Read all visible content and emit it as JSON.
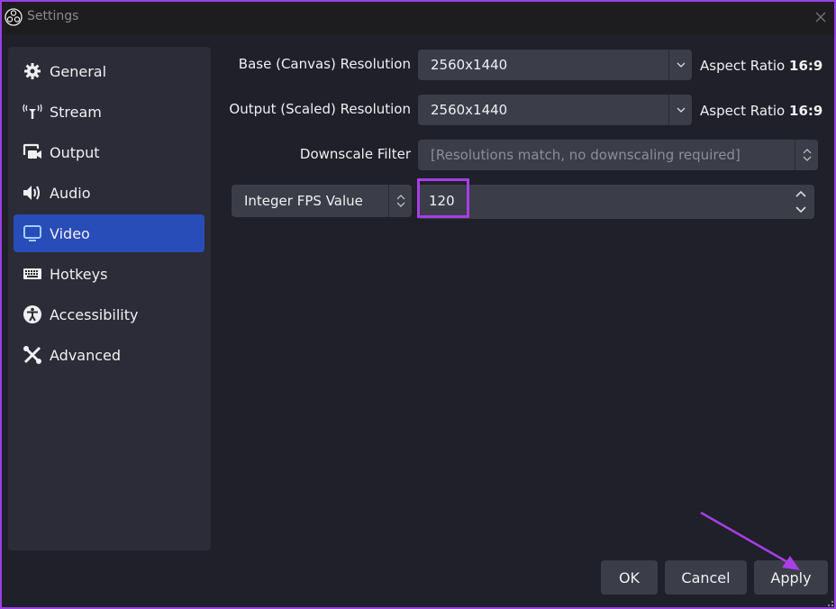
{
  "window": {
    "title": "Settings"
  },
  "sidebar": {
    "items": [
      {
        "label": "General",
        "icon": "gear-icon"
      },
      {
        "label": "Stream",
        "icon": "antenna-icon"
      },
      {
        "label": "Output",
        "icon": "output-icon"
      },
      {
        "label": "Audio",
        "icon": "speaker-icon"
      },
      {
        "label": "Video",
        "icon": "monitor-icon",
        "active": true
      },
      {
        "label": "Hotkeys",
        "icon": "keyboard-icon"
      },
      {
        "label": "Accessibility",
        "icon": "accessibility-icon"
      },
      {
        "label": "Advanced",
        "icon": "tools-icon"
      }
    ]
  },
  "video": {
    "base_resolution": {
      "label": "Base (Canvas) Resolution",
      "value": "2560x1440",
      "aspect_prefix": "Aspect Ratio",
      "aspect_value": "16:9"
    },
    "output_resolution": {
      "label": "Output (Scaled) Resolution",
      "value": "2560x1440",
      "aspect_prefix": "Aspect Ratio",
      "aspect_value": "16:9"
    },
    "downscale_filter": {
      "label": "Downscale Filter",
      "value": "[Resolutions match, no downscaling required]"
    },
    "fps": {
      "type": "Integer FPS Value",
      "value": "120"
    }
  },
  "buttons": {
    "ok": "OK",
    "cancel": "Cancel",
    "apply": "Apply"
  },
  "colors": {
    "accent": "#284cb8",
    "highlight": "#a73ee6"
  }
}
